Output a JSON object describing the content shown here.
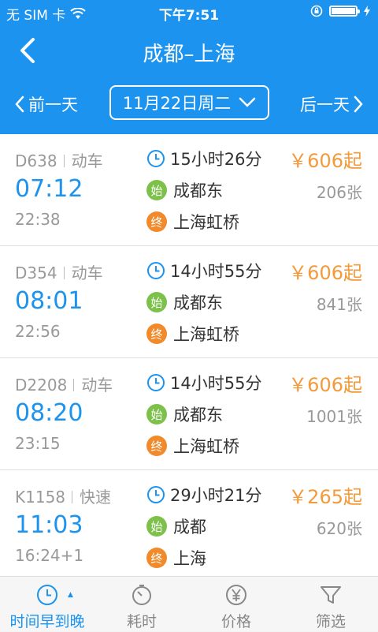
{
  "colors": {
    "accent": "#1b93ef",
    "price": "#f39a3a",
    "start_badge": "#7dc14a",
    "end_badge": "#f08a2b"
  },
  "status": {
    "carrier": "无 SIM 卡",
    "time": "下午7:51",
    "battery_level": 0.95
  },
  "header": {
    "title": "成都–上海",
    "back_icon": "chevron-left-icon"
  },
  "datebar": {
    "prev_label": "前一天",
    "date_label": "11月22日周二",
    "next_label": "后一天"
  },
  "trains": [
    {
      "code": "D638",
      "type": "动车",
      "depart": "07:12",
      "arrive": "22:38",
      "duration": "15小时26分",
      "from_badge": "始",
      "from": "成都东",
      "to_badge": "终",
      "to": "上海虹桥",
      "price": "￥606起",
      "seats": "206张"
    },
    {
      "code": "D354",
      "type": "动车",
      "depart": "08:01",
      "arrive": "22:56",
      "duration": "14小时55分",
      "from_badge": "始",
      "from": "成都东",
      "to_badge": "终",
      "to": "上海虹桥",
      "price": "￥606起",
      "seats": "841张"
    },
    {
      "code": "D2208",
      "type": "动车",
      "depart": "08:20",
      "arrive": "23:15",
      "duration": "14小时55分",
      "from_badge": "始",
      "from": "成都东",
      "to_badge": "终",
      "to": "上海虹桥",
      "price": "￥606起",
      "seats": "1001张"
    },
    {
      "code": "K1158",
      "type": "快速",
      "depart": "11:03",
      "arrive": "16:24+1",
      "duration": "29小时21分",
      "from_badge": "始",
      "from": "成都",
      "to_badge": "终",
      "to": "上海",
      "price": "￥265起",
      "seats": "620张"
    }
  ],
  "tabs": [
    {
      "label": "时间早到晚",
      "icon": "clock-icon",
      "active": true
    },
    {
      "label": "耗时",
      "icon": "stopwatch-icon",
      "active": false
    },
    {
      "label": "价格",
      "icon": "yen-icon",
      "active": false
    },
    {
      "label": "筛选",
      "icon": "filter-icon",
      "active": false
    }
  ]
}
